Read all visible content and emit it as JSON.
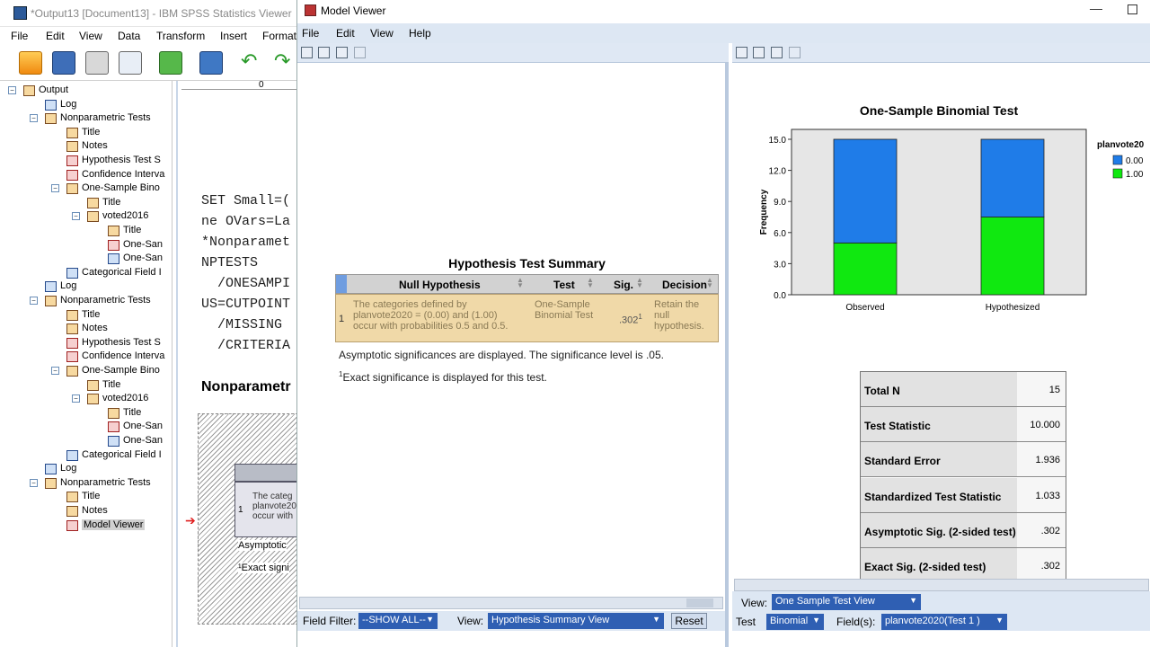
{
  "main_window": {
    "title": "*Output13 [Document13] - IBM SPSS Statistics Viewer",
    "menu": [
      "File",
      "Edit",
      "View",
      "Data",
      "Transform",
      "Insert",
      "Format"
    ],
    "toolbar_icons": [
      "open-icon",
      "save-icon",
      "print-icon",
      "print-preview-icon",
      "export-icon",
      "dialog-recall-icon",
      "undo-icon",
      "redo-icon"
    ],
    "ruler_value": "0"
  },
  "outline": {
    "items": [
      {
        "label": "Output"
      },
      {
        "label": "Log"
      },
      {
        "label": "Nonparametric Tests"
      },
      {
        "label": "Title"
      },
      {
        "label": "Notes"
      },
      {
        "label": "Hypothesis Test S"
      },
      {
        "label": "Confidence Interva"
      },
      {
        "label": "One-Sample Bino"
      },
      {
        "label": "Title"
      },
      {
        "label": "voted2016"
      },
      {
        "label": "Title"
      },
      {
        "label": "One-San"
      },
      {
        "label": "One-San"
      },
      {
        "label": "Categorical Field I"
      },
      {
        "label": "Log"
      },
      {
        "label": "Nonparametric Tests"
      },
      {
        "label": "Title"
      },
      {
        "label": "Notes"
      },
      {
        "label": "Hypothesis Test S"
      },
      {
        "label": "Confidence Interva"
      },
      {
        "label": "One-Sample Bino"
      },
      {
        "label": "Title"
      },
      {
        "label": "voted2016"
      },
      {
        "label": "Title"
      },
      {
        "label": "One-San"
      },
      {
        "label": "One-San"
      },
      {
        "label": "Categorical Field I"
      },
      {
        "label": "Log"
      },
      {
        "label": "Nonparametric Tests"
      },
      {
        "label": "Title"
      },
      {
        "label": "Notes"
      },
      {
        "label": "Model Viewer"
      }
    ]
  },
  "content": {
    "syntax": [
      "SET Small=(",
      "ne OVars=La",
      "*Nonparamet",
      "NPTESTS",
      "  /ONESAMPI",
      "US=CUTPOINT",
      "  /MISSING",
      "  /CRITERIA"
    ],
    "heading": "Nonparametr",
    "table_text": [
      "The categ",
      "planvote20",
      "occur with"
    ],
    "row_num": "1",
    "footer1": "Asymptotic",
    "footer2": "¹Exact signi"
  },
  "model_viewer": {
    "title": "Model Viewer",
    "menu": [
      "File",
      "Edit",
      "View",
      "Help"
    ],
    "hypothesis": {
      "title": "Hypothesis Test Summary",
      "headers": [
        "Null Hypothesis",
        "Test",
        "Sig.",
        "Decision"
      ],
      "row_num": "1",
      "null_hypothesis": "The categories defined by planvote2020 = (0.00) and (1.00) occur with probabilities 0.5 and 0.5.",
      "test": "One-Sample Binomial Test",
      "sig": ".302",
      "sig_sup": "1",
      "decision": "Retain the null hypothesis.",
      "note1": "Asymptotic significances are displayed.  The significance level is .05.",
      "note2_sup": "1",
      "note2": "Exact significance is displayed for this test."
    },
    "left_bottom": {
      "field_filter_label": "Field Filter:",
      "field_filter_value": "--SHOW ALL--",
      "view_label": "View:",
      "view_value": "Hypothesis Summary View",
      "reset": "Reset"
    },
    "right_bottom": {
      "view_label": "View:",
      "view_value": "One Sample Test View",
      "test_label": "Test",
      "test_value": "Binomial",
      "fields_label": "Field(s):",
      "fields_value": "planvote2020(Test 1 )"
    },
    "stats": [
      {
        "label": "Total N",
        "value": "15"
      },
      {
        "label": "Test Statistic",
        "value": "10.000"
      },
      {
        "label": "Standard Error",
        "value": "1.936"
      },
      {
        "label": "Standardized Test Statistic",
        "value": "1.033"
      },
      {
        "label": "Asymptotic Sig. (2-sided test)",
        "value": ".302"
      },
      {
        "label": "Exact Sig. (2-sided test)",
        "value": ".302"
      }
    ],
    "colors": {
      "series0": "#1f7ce8",
      "series1": "#10e810"
    }
  },
  "chart_data": {
    "type": "bar",
    "title": "One-Sample Binomial Test",
    "ylabel": "Frequency",
    "categories": [
      "Observed",
      "Hypothesized"
    ],
    "series": [
      {
        "name": "1.00",
        "values": [
          5.0,
          7.5
        ]
      },
      {
        "name": "0.00",
        "values": [
          10.0,
          7.5
        ]
      }
    ],
    "stacked": true,
    "ylim": [
      0,
      15
    ],
    "yticks": [
      "0.0",
      "3.0",
      "6.0",
      "9.0",
      "12.0",
      "15.0"
    ],
    "legend_title": "planvote20",
    "legend_entries": [
      "0.00",
      "1.00"
    ],
    "legend_position": "right",
    "grid": false
  }
}
